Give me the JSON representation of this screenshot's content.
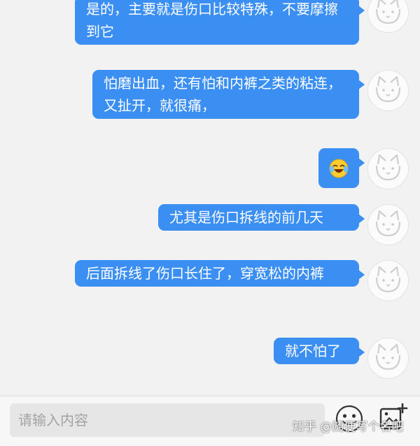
{
  "messages": [
    {
      "text": "是的，主要就是伤口比较特殊，不要摩擦到它"
    },
    {
      "text": "怕磨出血，还有怕和内裤之类的粘连，又扯开，就很痛，"
    },
    {
      "emoji": "laugh-cry-emoji"
    },
    {
      "text": "尤其是伤口拆线的前几天"
    },
    {
      "text": "后面拆线了伤口长住了，穿宽松的内裤"
    },
    {
      "text": "就不怕了"
    }
  ],
  "input": {
    "placeholder": "请输入内容"
  },
  "watermark": "知乎 @随便写个名吧",
  "colors": {
    "bubble": "#3b8ff2",
    "background": "#f2f2f2"
  }
}
